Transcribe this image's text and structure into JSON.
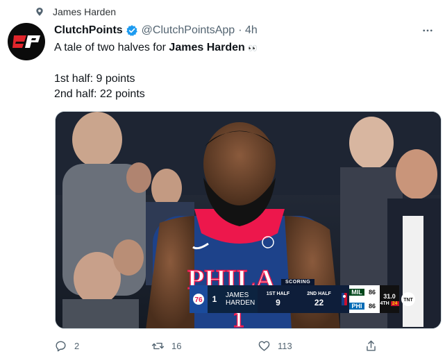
{
  "context": {
    "icon": "pin-icon",
    "text": "James Harden"
  },
  "author": {
    "display_name": "ClutchPoints",
    "handle": "@ClutchPointsApp",
    "time": "· 4h",
    "avatar_text": "CP",
    "verified_color": "#1d9bf0"
  },
  "tweet": {
    "lead": "A tale of two halves for ",
    "lead_bold": "James Harden",
    "emoji": "👀",
    "line1": "1st half: 9 points",
    "line2": "2nd half: 22 points"
  },
  "media": {
    "jersey_text": "PHILA",
    "jersey_number": "1",
    "scorebug": {
      "team_number": "1",
      "player_first": "JAMES",
      "player_last": "HARDEN",
      "scoring_title": "SCORING",
      "col1_label": "1ST HALF",
      "col1_value": "9",
      "col2_label": "2ND HALF",
      "col2_value": "22",
      "team1": "MIL",
      "team1_score": "86",
      "team2": "PHI",
      "team2_score": "86",
      "clock": "31.0",
      "quarter": "4TH",
      "shot_clock": "24",
      "network": "TNT"
    }
  },
  "actions": {
    "reply_count": "2",
    "retweet_count": "16",
    "like_count": "113"
  },
  "colors": {
    "accent": "#1d9bf0",
    "muted": "#536471",
    "sixers_blue": "#1d428a",
    "sixers_red": "#ed174c"
  }
}
